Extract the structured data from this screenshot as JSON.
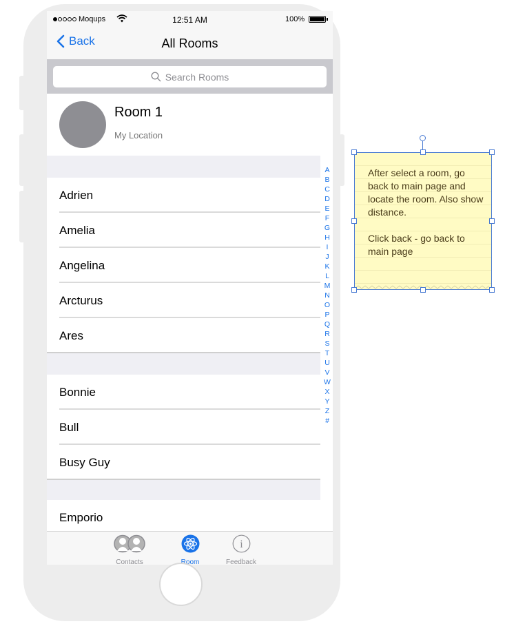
{
  "status_bar": {
    "carrier": "Moqups",
    "time": "12:51 AM",
    "battery_percent": "100%"
  },
  "nav": {
    "back_label": "Back",
    "title": "All Rooms"
  },
  "search": {
    "placeholder": "Search Rooms"
  },
  "current_location": {
    "room_name": "Room 1",
    "subtitle": "My Location"
  },
  "rooms": {
    "section_a": [
      "Adrien",
      "Amelia",
      "Angelina",
      "Arcturus",
      "Ares"
    ],
    "section_b": [
      "Bonnie",
      "Bull",
      "Busy Guy"
    ],
    "section_e": [
      "Emporio"
    ]
  },
  "index_letters": [
    "A",
    "B",
    "C",
    "D",
    "E",
    "F",
    "G",
    "H",
    "I",
    "J",
    "K",
    "L",
    "M",
    "N",
    "O",
    "P",
    "Q",
    "R",
    "S",
    "T",
    "U",
    "V",
    "W",
    "X",
    "Y",
    "Z",
    "#"
  ],
  "tab_bar": {
    "tabs": [
      {
        "label": "Contacts",
        "icon": "contacts-icon",
        "active": false
      },
      {
        "label": "Room",
        "icon": "atom-icon",
        "active": true
      },
      {
        "label": "Feedback",
        "icon": "info-icon",
        "active": false
      }
    ]
  },
  "sticky_note": {
    "text": "After select a room, go back to main page and locate the room. Also show distance.\n\nClick back - go back to main page"
  },
  "colors": {
    "accent": "#1a73e8",
    "note_background": "#fffbc4",
    "selection": "#4a7bd3"
  }
}
